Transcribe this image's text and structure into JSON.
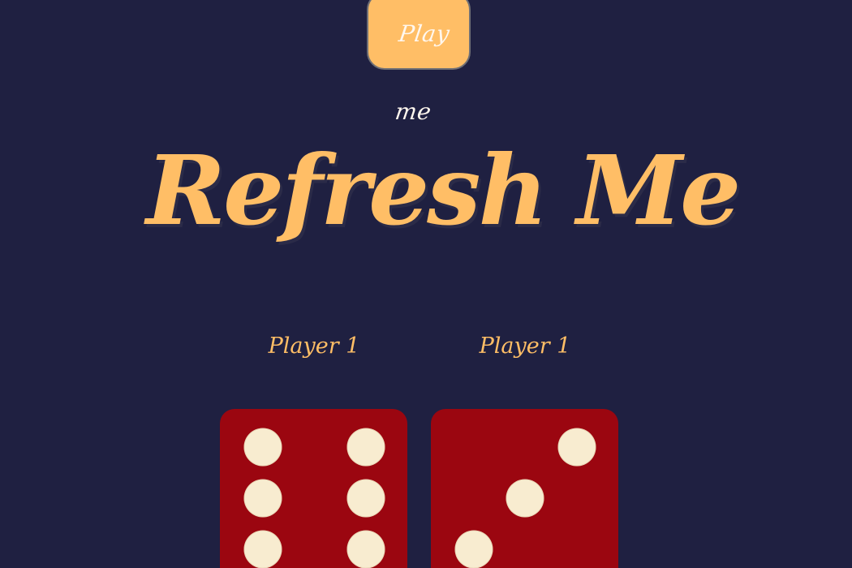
{
  "header": {
    "play_button_label": "Play me"
  },
  "main": {
    "title": "Refresh Me",
    "players": [
      {
        "label": "Player 1",
        "die_value": 6
      },
      {
        "label": "Player 1",
        "die_value": 3
      }
    ]
  },
  "colors": {
    "background": "#1f2041",
    "accent": "#ffbe66",
    "die": "#9b0610",
    "pip": "#f8ecd0"
  }
}
